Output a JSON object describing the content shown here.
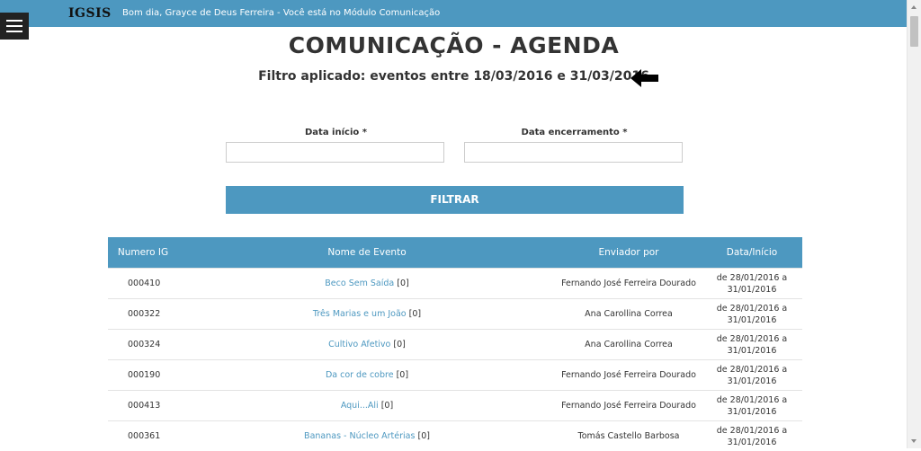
{
  "header": {
    "logo": "IGSIS",
    "greeting": "Bom dia, Grayce de Deus Ferreira - Você está no Módulo Comunicação"
  },
  "page": {
    "title": "COMUNICAÇÃO - AGENDA",
    "filter_text": "Filtro aplicado: eventos entre 18/03/2016 e 31/03/2016"
  },
  "form": {
    "start_label": "Data início *",
    "start_value": "",
    "end_label": "Data encerramento *",
    "end_value": "",
    "filter_button": "FILTRAR"
  },
  "table": {
    "columns": [
      "Numero IG",
      "Nome de Evento",
      "Enviador por",
      "Data/Início"
    ],
    "rows": [
      {
        "num": "000410",
        "event": "Beco Sem Saída",
        "count": "[0]",
        "sender": "Fernando José Ferreira Dourado",
        "date1": "de 28/01/2016 a",
        "date2": "31/01/2016"
      },
      {
        "num": "000322",
        "event": "Três Marias e um João",
        "count": "[0]",
        "sender": "Ana Carollina Correa",
        "date1": "de 28/01/2016 a",
        "date2": "31/01/2016"
      },
      {
        "num": "000324",
        "event": "Cultivo Afetivo",
        "count": "[0]",
        "sender": "Ana Carollina Correa",
        "date1": "de 28/01/2016 a",
        "date2": "31/01/2016"
      },
      {
        "num": "000190",
        "event": "Da cor de cobre",
        "count": "[0]",
        "sender": "Fernando José Ferreira Dourado",
        "date1": "de 28/01/2016 a",
        "date2": "31/01/2016"
      },
      {
        "num": "000413",
        "event": "Aqui...Ali",
        "count": "[0]",
        "sender": "Fernando José Ferreira Dourado",
        "date1": "de 28/01/2016 a",
        "date2": "31/01/2016"
      },
      {
        "num": "000361",
        "event": "Bananas - Núcleo Artérias",
        "count": "[0]",
        "sender": "Tomás Castello Barbosa",
        "date1": "de 28/01/2016 a",
        "date2": "31/01/2016"
      }
    ]
  }
}
